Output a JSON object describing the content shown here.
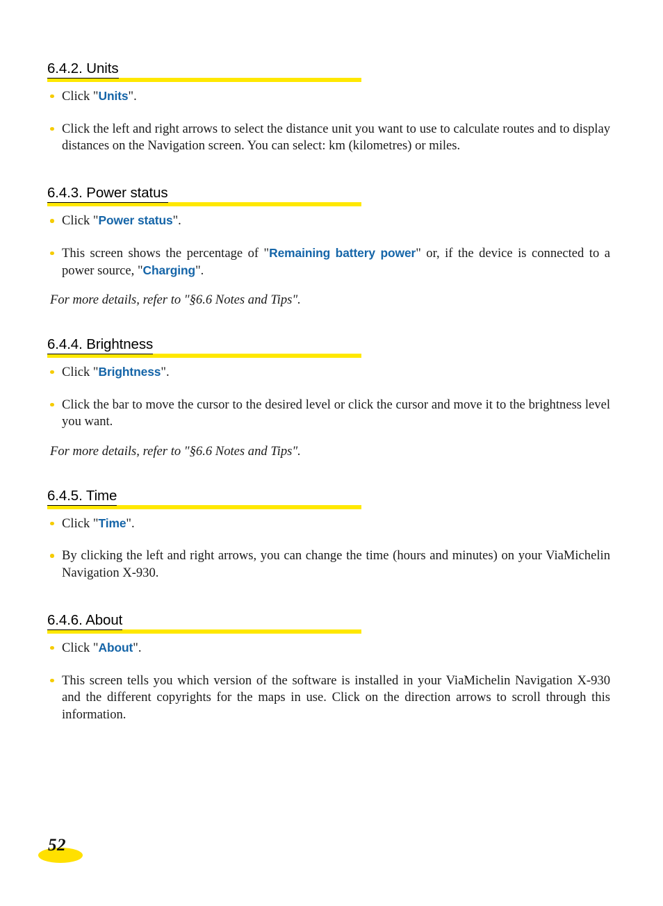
{
  "document": {
    "page_number": "52",
    "product_name": "ViaMichelin Navigation X-930",
    "colors": {
      "heading_bar": "#FFE800",
      "bullet": "#F5CB00",
      "link_blue": "#1565A8",
      "page_number_ellipse": "#FFE000",
      "text": "#1A1A1A"
    }
  },
  "sections": [
    {
      "heading": "6.4.2. Units",
      "bullets": [
        {
          "parts": [
            {
              "text": "Click \"",
              "style": "plain"
            },
            {
              "text": "Units",
              "style": "blue"
            },
            {
              "text": "\".",
              "style": "plain"
            }
          ],
          "single_line": true
        },
        {
          "parts": [
            {
              "text": "Click the left and right arrows to select the distance unit you want to use to calculate routes and to display distances on the Navigation screen. You can select: km (kilometres) or miles.",
              "style": "plain"
            }
          ],
          "single_line": false
        }
      ],
      "note": null
    },
    {
      "heading": "6.4.3. Power status",
      "bullets": [
        {
          "parts": [
            {
              "text": "Click \"",
              "style": "plain"
            },
            {
              "text": "Power status",
              "style": "blue"
            },
            {
              "text": "\".",
              "style": "plain"
            }
          ],
          "single_line": true
        },
        {
          "parts": [
            {
              "text": "This screen shows the percentage of \"",
              "style": "plain"
            },
            {
              "text": "Remaining battery power",
              "style": "blue"
            },
            {
              "text": "\" or, if the device is connected to a power source, \"",
              "style": "plain"
            },
            {
              "text": "Charging",
              "style": "blue"
            },
            {
              "text": "\".",
              "style": "plain"
            }
          ],
          "single_line": false
        }
      ],
      "note": "For more details, refer to \"§6.6 Notes and Tips\"."
    },
    {
      "heading": "6.4.4. Brightness",
      "bullets": [
        {
          "parts": [
            {
              "text": "Click \"",
              "style": "plain"
            },
            {
              "text": "Brightness",
              "style": "blue"
            },
            {
              "text": "\".",
              "style": "plain"
            }
          ],
          "single_line": true
        },
        {
          "parts": [
            {
              "text": "Click the bar to move the cursor to the desired level or click the cursor and move it to the brightness level you want.",
              "style": "plain"
            }
          ],
          "single_line": false
        }
      ],
      "note": "For more details, refer to \"§6.6 Notes and Tips\"."
    },
    {
      "heading": "6.4.5. Time",
      "bullets": [
        {
          "parts": [
            {
              "text": "Click \"",
              "style": "plain"
            },
            {
              "text": "Time",
              "style": "blue"
            },
            {
              "text": "\".",
              "style": "plain"
            }
          ],
          "single_line": true
        },
        {
          "parts": [
            {
              "text": "By clicking the left and right arrows, you can change the time (hours and minutes) on your ViaMichelin Navigation X-930.",
              "style": "plain"
            }
          ],
          "single_line": false
        }
      ],
      "note": null
    },
    {
      "heading": "6.4.6. About",
      "bullets": [
        {
          "parts": [
            {
              "text": "Click \"",
              "style": "plain"
            },
            {
              "text": "About",
              "style": "blue"
            },
            {
              "text": "\".",
              "style": "plain"
            }
          ],
          "single_line": true
        },
        {
          "parts": [
            {
              "text": "This screen tells you which version of the software is installed in your ViaMichelin Navigation X-930 and the different copyrights for the maps in use. Click on the direction arrows to scroll through this information.",
              "style": "plain"
            }
          ],
          "single_line": false
        }
      ],
      "note": null
    }
  ]
}
